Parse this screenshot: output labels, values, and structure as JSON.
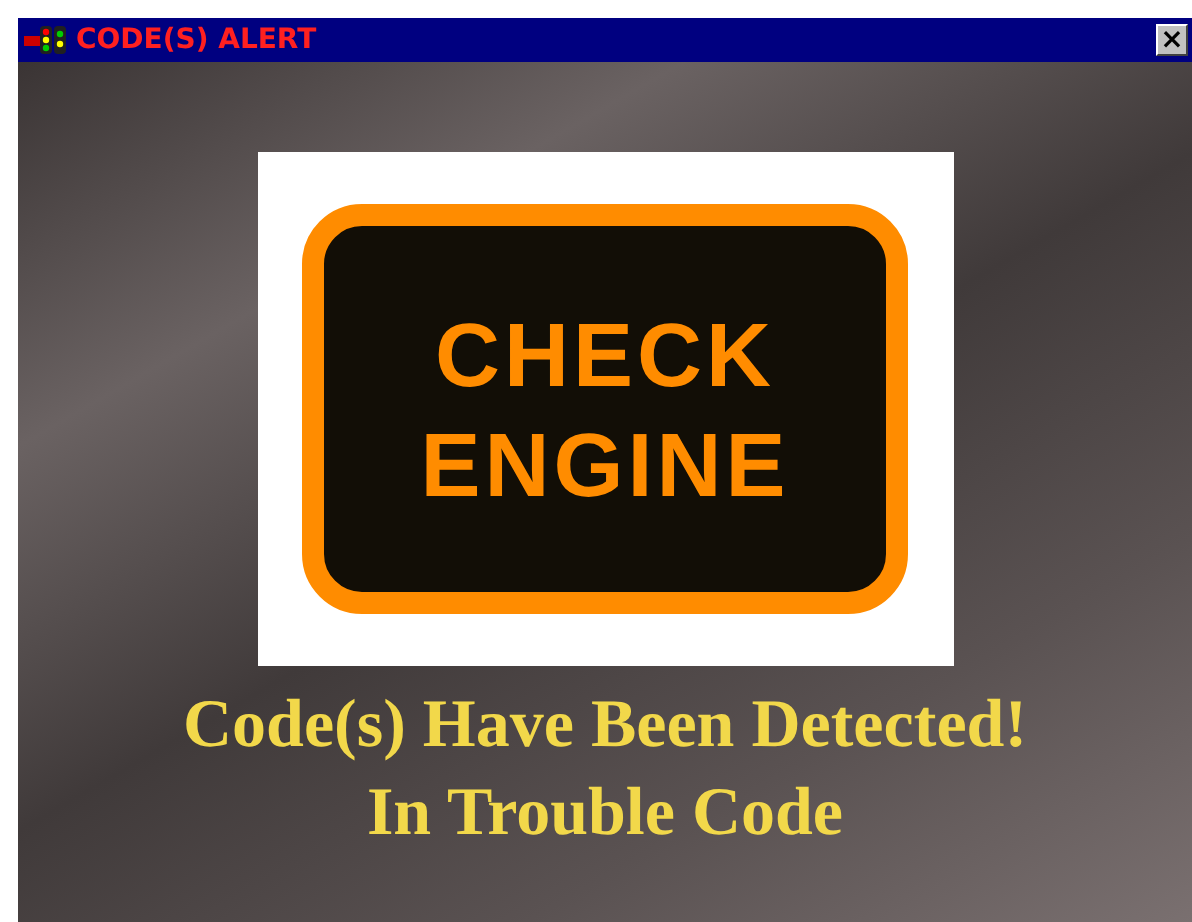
{
  "window": {
    "title": "CODE(S) ALERT",
    "close_label": "×"
  },
  "sign": {
    "lines": [
      "CHECK",
      "ENGINE"
    ]
  },
  "message": [
    "Code(s) Have Been Detected!",
    "In Trouble Code"
  ]
}
